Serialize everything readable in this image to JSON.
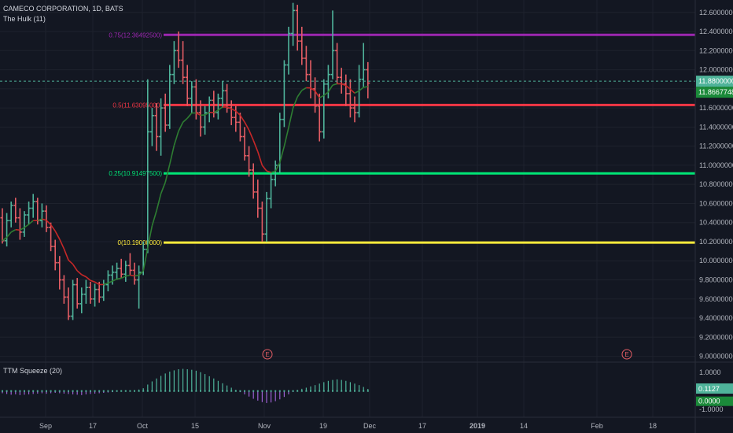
{
  "header": {
    "symbol_title": "CAMECO CORPORATION, 1D, BATS",
    "indicator_name": "The Hulk (11)"
  },
  "lower_pane": {
    "indicator_name": "TTM Squeeze (20)"
  },
  "colors": {
    "background": "#131722",
    "grid": "#1e222d",
    "bull": "#4fb39a",
    "bear": "#e35d64",
    "hulk_up": "#2e7d32",
    "hulk_down": "#c62828",
    "hulk_neutral": "#9e9e9e",
    "fib_075": "#9c27b0",
    "fib_05": "#f23645",
    "fib_025": "#00e676",
    "fib_0": "#ffeb3b",
    "price_line": "#4fb39a",
    "squeeze_pos": "#4fb39a",
    "squeeze_neg": "#9c5fd1"
  },
  "chart_data": [
    {
      "type": "ohlc",
      "title": "CAMECO CORPORATION, 1D, BATS",
      "y_ticks": [
        "12.60000000",
        "12.40000000",
        "12.20000000",
        "12.00000000",
        "11.80000000",
        "11.60000000",
        "11.40000000",
        "11.20000000",
        "11.00000000",
        "10.80000000",
        "10.60000000",
        "10.40000000",
        "10.20000000",
        "10.00000000",
        "9.80000000",
        "9.60000000",
        "9.40000000",
        "9.20000000",
        "9.00000000"
      ],
      "ylim": [
        8.98,
        12.73
      ],
      "x_labels": [
        "Sep",
        "17",
        "Oct",
        "15",
        "Nov",
        "19",
        "Dec",
        "17",
        "2019",
        "14",
        "Feb",
        "18"
      ],
      "bars": [
        [
          10.45,
          10.55,
          10.18,
          10.21
        ],
        [
          10.21,
          10.5,
          10.15,
          10.42
        ],
        [
          10.42,
          10.62,
          10.35,
          10.58
        ],
        [
          10.58,
          10.66,
          10.4,
          10.45
        ],
        [
          10.45,
          10.55,
          10.22,
          10.3
        ],
        [
          10.3,
          10.52,
          10.25,
          10.48
        ],
        [
          10.48,
          10.62,
          10.38,
          10.55
        ],
        [
          10.55,
          10.7,
          10.45,
          10.62
        ],
        [
          10.62,
          10.66,
          10.38,
          10.42
        ],
        [
          10.42,
          10.6,
          10.35,
          10.52
        ],
        [
          10.52,
          10.58,
          10.3,
          10.35
        ],
        [
          10.35,
          10.4,
          10.1,
          10.15
        ],
        [
          10.15,
          10.22,
          9.9,
          9.98
        ],
        [
          9.98,
          10.05,
          9.7,
          9.8
        ],
        [
          9.8,
          9.85,
          9.55,
          9.62
        ],
        [
          9.62,
          9.72,
          9.38,
          9.42
        ],
        [
          9.42,
          9.8,
          9.38,
          9.75
        ],
        [
          9.75,
          9.82,
          9.5,
          9.55
        ],
        [
          9.55,
          9.72,
          9.45,
          9.65
        ],
        [
          9.65,
          9.8,
          9.55,
          9.72
        ],
        [
          9.72,
          9.78,
          9.55,
          9.6
        ],
        [
          9.6,
          9.76,
          9.52,
          9.7
        ],
        [
          9.7,
          9.78,
          9.56,
          9.62
        ],
        [
          9.62,
          9.8,
          9.58,
          9.75
        ],
        [
          9.75,
          9.9,
          9.68,
          9.85
        ],
        [
          9.85,
          9.95,
          9.75,
          9.88
        ],
        [
          9.88,
          9.98,
          9.8,
          9.92
        ],
        [
          9.92,
          10.02,
          9.82,
          9.86
        ],
        [
          9.86,
          10.0,
          9.78,
          9.95
        ],
        [
          9.95,
          10.08,
          9.85,
          9.9
        ],
        [
          9.9,
          9.98,
          9.75,
          9.8
        ],
        [
          9.8,
          9.95,
          9.5,
          9.88
        ],
        [
          9.88,
          10.2,
          9.85,
          10.12
        ],
        [
          10.12,
          11.9,
          10.08,
          11.35
        ],
        [
          11.35,
          11.6,
          11.2,
          11.52
        ],
        [
          11.52,
          11.65,
          11.15,
          11.3
        ],
        [
          11.3,
          11.7,
          11.1,
          11.6
        ],
        [
          11.6,
          11.75,
          11.35,
          11.42
        ],
        [
          11.42,
          12.05,
          11.38,
          11.95
        ],
        [
          11.95,
          12.3,
          11.85,
          12.2
        ],
        [
          12.2,
          12.4,
          12.02,
          12.1
        ],
        [
          12.1,
          12.3,
          11.85,
          11.92
        ],
        [
          11.92,
          12.05,
          11.62,
          11.7
        ],
        [
          11.7,
          11.88,
          11.55,
          11.82
        ],
        [
          11.82,
          11.9,
          11.48,
          11.55
        ],
        [
          11.55,
          11.68,
          11.3,
          11.4
        ],
        [
          11.4,
          11.62,
          11.32,
          11.55
        ],
        [
          11.55,
          11.72,
          11.45,
          11.68
        ],
        [
          11.68,
          11.78,
          11.5,
          11.55
        ],
        [
          11.55,
          11.75,
          11.48,
          11.7
        ],
        [
          11.7,
          11.88,
          11.6,
          11.78
        ],
        [
          11.78,
          11.85,
          11.55,
          11.6
        ],
        [
          11.6,
          11.68,
          11.42,
          11.5
        ],
        [
          11.5,
          11.62,
          11.35,
          11.45
        ],
        [
          11.45,
          11.55,
          11.25,
          11.3
        ],
        [
          11.3,
          11.4,
          11.05,
          11.1
        ],
        [
          11.1,
          11.2,
          10.88,
          10.95
        ],
        [
          10.95,
          11.02,
          10.65,
          10.72
        ],
        [
          10.72,
          10.85,
          10.45,
          10.55
        ],
        [
          10.55,
          10.62,
          10.2,
          10.28
        ],
        [
          10.28,
          10.72,
          10.2,
          10.65
        ],
        [
          10.65,
          10.92,
          10.55,
          10.85
        ],
        [
          10.85,
          11.05,
          10.78,
          11.0
        ],
        [
          11.0,
          11.55,
          10.92,
          11.48
        ],
        [
          11.48,
          12.1,
          11.4,
          12.05
        ],
        [
          12.05,
          12.45,
          11.95,
          12.38
        ],
        [
          12.38,
          12.7,
          12.25,
          12.62
        ],
        [
          12.62,
          12.68,
          12.2,
          12.3
        ],
        [
          12.3,
          12.45,
          12.05,
          12.12
        ],
        [
          12.12,
          12.25,
          11.88,
          11.95
        ],
        [
          11.95,
          12.1,
          11.7,
          11.8
        ],
        [
          11.8,
          11.92,
          11.55,
          11.62
        ],
        [
          11.62,
          11.75,
          11.25,
          11.35
        ],
        [
          11.35,
          11.9,
          11.28,
          11.85
        ],
        [
          11.85,
          12.05,
          11.7,
          11.95
        ],
        [
          11.95,
          12.62,
          11.9,
          12.2
        ],
        [
          12.2,
          12.28,
          11.85,
          11.92
        ],
        [
          11.92,
          12.02,
          11.75,
          11.85
        ],
        [
          11.85,
          11.95,
          11.62,
          11.75
        ],
        [
          11.75,
          11.9,
          11.5,
          11.6
        ],
        [
          11.6,
          11.72,
          11.45,
          11.55
        ],
        [
          11.55,
          12.05,
          11.5,
          11.9
        ],
        [
          11.9,
          12.28,
          11.82,
          12.0
        ],
        [
          12.0,
          12.08,
          11.7,
          11.86
        ]
      ],
      "fib_levels": [
        {
          "label": "0.75(12.36492500)",
          "value": 12.364925
        },
        {
          "label": "0.5(11.63095000)",
          "value": 11.63095
        },
        {
          "label": "0.25(10.91497500)",
          "value": 10.914975
        },
        {
          "label": "0(10.19000000)",
          "value": 10.19
        }
      ],
      "current_price": {
        "label": "11.88000000",
        "value": 11.88
      },
      "hulk_value": {
        "label": "11.86677489",
        "value": 11.86677489
      },
      "events": [
        "E",
        "E"
      ]
    },
    {
      "type": "bar",
      "title": "TTM Squeeze (20)",
      "y_ticks": [
        "1.0000",
        "-1.0000"
      ],
      "ylim": [
        -1.25,
        1.35
      ],
      "momentum": [
        -0.12,
        -0.16,
        -0.2,
        -0.18,
        -0.22,
        -0.2,
        -0.18,
        -0.16,
        -0.14,
        -0.12,
        -0.15,
        -0.12,
        -0.1,
        -0.12,
        -0.14,
        -0.16,
        -0.18,
        -0.2,
        -0.22,
        -0.18,
        -0.16,
        -0.14,
        -0.12,
        -0.1,
        -0.08,
        -0.06,
        -0.04,
        -0.03,
        -0.02,
        0.02,
        0.04,
        0.08,
        0.15,
        0.35,
        0.52,
        0.68,
        0.82,
        0.95,
        1.05,
        1.12,
        1.18,
        1.2,
        1.18,
        1.15,
        1.1,
        1.02,
        0.92,
        0.8,
        0.68,
        0.55,
        0.42,
        0.3,
        0.18,
        0.06,
        -0.06,
        -0.18,
        -0.3,
        -0.42,
        -0.52,
        -0.6,
        -0.65,
        -0.62,
        -0.55,
        -0.45,
        -0.32,
        -0.18,
        -0.05,
        0.06,
        0.12,
        0.18,
        0.25,
        0.32,
        0.4,
        0.48,
        0.55,
        0.6,
        0.63,
        0.6,
        0.55,
        0.48,
        0.4,
        0.32,
        0.22,
        0.1127
      ],
      "labels": {
        "value": "0.1127",
        "zero": "0.0000"
      }
    }
  ]
}
